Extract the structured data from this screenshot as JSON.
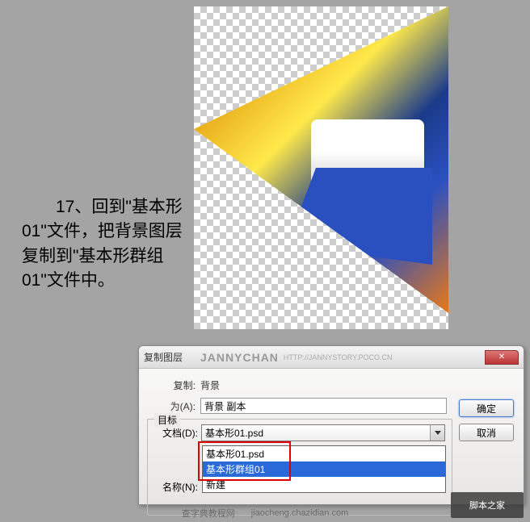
{
  "instruction": "　　17、回到\"基本形01\"文件，把背景图层复制到\"基本形群组01\"文件中。",
  "dialog": {
    "title": "复制图层",
    "watermark": "JANNYCHAN",
    "url": "HTTP://JANNYSTORY.POCO.CN",
    "copy_label": "复制:",
    "copy_value": "背景",
    "as_label": "为(A):",
    "as_value": "背景 副本",
    "target_legend": "目标",
    "doc_label": "文档(D):",
    "doc_value": "基本形01.psd",
    "name_label": "名称(N):",
    "dropdown": {
      "items": [
        "基本形01.psd",
        "基本形群组01",
        "新建"
      ],
      "selected_index": 1
    },
    "ok": "确定",
    "cancel": "取消"
  },
  "footer": {
    "site": "查字典教程网",
    "url": "jiaocheng.chazidian.com",
    "brand": "脚本之家"
  }
}
